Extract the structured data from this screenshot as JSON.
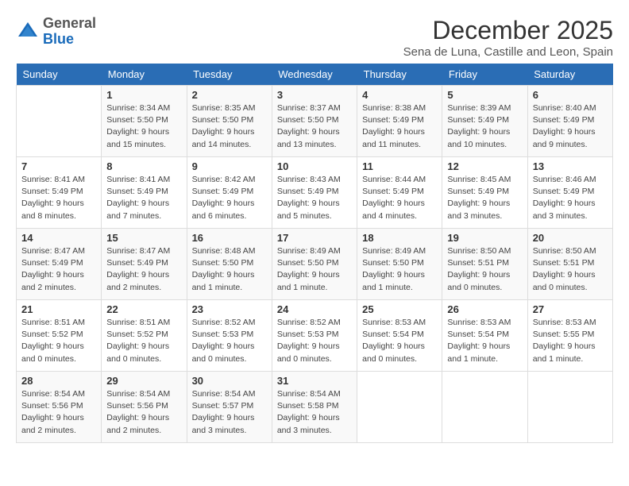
{
  "header": {
    "logo_general": "General",
    "logo_blue": "Blue",
    "month_title": "December 2025",
    "subtitle": "Sena de Luna, Castille and Leon, Spain"
  },
  "days_of_week": [
    "Sunday",
    "Monday",
    "Tuesday",
    "Wednesday",
    "Thursday",
    "Friday",
    "Saturday"
  ],
  "weeks": [
    [
      {
        "day": "",
        "sunrise": "",
        "sunset": "",
        "daylight": ""
      },
      {
        "day": "1",
        "sunrise": "Sunrise: 8:34 AM",
        "sunset": "Sunset: 5:50 PM",
        "daylight": "Daylight: 9 hours and 15 minutes."
      },
      {
        "day": "2",
        "sunrise": "Sunrise: 8:35 AM",
        "sunset": "Sunset: 5:50 PM",
        "daylight": "Daylight: 9 hours and 14 minutes."
      },
      {
        "day": "3",
        "sunrise": "Sunrise: 8:37 AM",
        "sunset": "Sunset: 5:50 PM",
        "daylight": "Daylight: 9 hours and 13 minutes."
      },
      {
        "day": "4",
        "sunrise": "Sunrise: 8:38 AM",
        "sunset": "Sunset: 5:49 PM",
        "daylight": "Daylight: 9 hours and 11 minutes."
      },
      {
        "day": "5",
        "sunrise": "Sunrise: 8:39 AM",
        "sunset": "Sunset: 5:49 PM",
        "daylight": "Daylight: 9 hours and 10 minutes."
      },
      {
        "day": "6",
        "sunrise": "Sunrise: 8:40 AM",
        "sunset": "Sunset: 5:49 PM",
        "daylight": "Daylight: 9 hours and 9 minutes."
      }
    ],
    [
      {
        "day": "7",
        "sunrise": "Sunrise: 8:41 AM",
        "sunset": "Sunset: 5:49 PM",
        "daylight": "Daylight: 9 hours and 8 minutes."
      },
      {
        "day": "8",
        "sunrise": "Sunrise: 8:41 AM",
        "sunset": "Sunset: 5:49 PM",
        "daylight": "Daylight: 9 hours and 7 minutes."
      },
      {
        "day": "9",
        "sunrise": "Sunrise: 8:42 AM",
        "sunset": "Sunset: 5:49 PM",
        "daylight": "Daylight: 9 hours and 6 minutes."
      },
      {
        "day": "10",
        "sunrise": "Sunrise: 8:43 AM",
        "sunset": "Sunset: 5:49 PM",
        "daylight": "Daylight: 9 hours and 5 minutes."
      },
      {
        "day": "11",
        "sunrise": "Sunrise: 8:44 AM",
        "sunset": "Sunset: 5:49 PM",
        "daylight": "Daylight: 9 hours and 4 minutes."
      },
      {
        "day": "12",
        "sunrise": "Sunrise: 8:45 AM",
        "sunset": "Sunset: 5:49 PM",
        "daylight": "Daylight: 9 hours and 3 minutes."
      },
      {
        "day": "13",
        "sunrise": "Sunrise: 8:46 AM",
        "sunset": "Sunset: 5:49 PM",
        "daylight": "Daylight: 9 hours and 3 minutes."
      }
    ],
    [
      {
        "day": "14",
        "sunrise": "Sunrise: 8:47 AM",
        "sunset": "Sunset: 5:49 PM",
        "daylight": "Daylight: 9 hours and 2 minutes."
      },
      {
        "day": "15",
        "sunrise": "Sunrise: 8:47 AM",
        "sunset": "Sunset: 5:49 PM",
        "daylight": "Daylight: 9 hours and 2 minutes."
      },
      {
        "day": "16",
        "sunrise": "Sunrise: 8:48 AM",
        "sunset": "Sunset: 5:50 PM",
        "daylight": "Daylight: 9 hours and 1 minute."
      },
      {
        "day": "17",
        "sunrise": "Sunrise: 8:49 AM",
        "sunset": "Sunset: 5:50 PM",
        "daylight": "Daylight: 9 hours and 1 minute."
      },
      {
        "day": "18",
        "sunrise": "Sunrise: 8:49 AM",
        "sunset": "Sunset: 5:50 PM",
        "daylight": "Daylight: 9 hours and 1 minute."
      },
      {
        "day": "19",
        "sunrise": "Sunrise: 8:50 AM",
        "sunset": "Sunset: 5:51 PM",
        "daylight": "Daylight: 9 hours and 0 minutes."
      },
      {
        "day": "20",
        "sunrise": "Sunrise: 8:50 AM",
        "sunset": "Sunset: 5:51 PM",
        "daylight": "Daylight: 9 hours and 0 minutes."
      }
    ],
    [
      {
        "day": "21",
        "sunrise": "Sunrise: 8:51 AM",
        "sunset": "Sunset: 5:52 PM",
        "daylight": "Daylight: 9 hours and 0 minutes."
      },
      {
        "day": "22",
        "sunrise": "Sunrise: 8:51 AM",
        "sunset": "Sunset: 5:52 PM",
        "daylight": "Daylight: 9 hours and 0 minutes."
      },
      {
        "day": "23",
        "sunrise": "Sunrise: 8:52 AM",
        "sunset": "Sunset: 5:53 PM",
        "daylight": "Daylight: 9 hours and 0 minutes."
      },
      {
        "day": "24",
        "sunrise": "Sunrise: 8:52 AM",
        "sunset": "Sunset: 5:53 PM",
        "daylight": "Daylight: 9 hours and 0 minutes."
      },
      {
        "day": "25",
        "sunrise": "Sunrise: 8:53 AM",
        "sunset": "Sunset: 5:54 PM",
        "daylight": "Daylight: 9 hours and 0 minutes."
      },
      {
        "day": "26",
        "sunrise": "Sunrise: 8:53 AM",
        "sunset": "Sunset: 5:54 PM",
        "daylight": "Daylight: 9 hours and 1 minute."
      },
      {
        "day": "27",
        "sunrise": "Sunrise: 8:53 AM",
        "sunset": "Sunset: 5:55 PM",
        "daylight": "Daylight: 9 hours and 1 minute."
      }
    ],
    [
      {
        "day": "28",
        "sunrise": "Sunrise: 8:54 AM",
        "sunset": "Sunset: 5:56 PM",
        "daylight": "Daylight: 9 hours and 2 minutes."
      },
      {
        "day": "29",
        "sunrise": "Sunrise: 8:54 AM",
        "sunset": "Sunset: 5:56 PM",
        "daylight": "Daylight: 9 hours and 2 minutes."
      },
      {
        "day": "30",
        "sunrise": "Sunrise: 8:54 AM",
        "sunset": "Sunset: 5:57 PM",
        "daylight": "Daylight: 9 hours and 3 minutes."
      },
      {
        "day": "31",
        "sunrise": "Sunrise: 8:54 AM",
        "sunset": "Sunset: 5:58 PM",
        "daylight": "Daylight: 9 hours and 3 minutes."
      },
      {
        "day": "",
        "sunrise": "",
        "sunset": "",
        "daylight": ""
      },
      {
        "day": "",
        "sunrise": "",
        "sunset": "",
        "daylight": ""
      },
      {
        "day": "",
        "sunrise": "",
        "sunset": "",
        "daylight": ""
      }
    ]
  ]
}
